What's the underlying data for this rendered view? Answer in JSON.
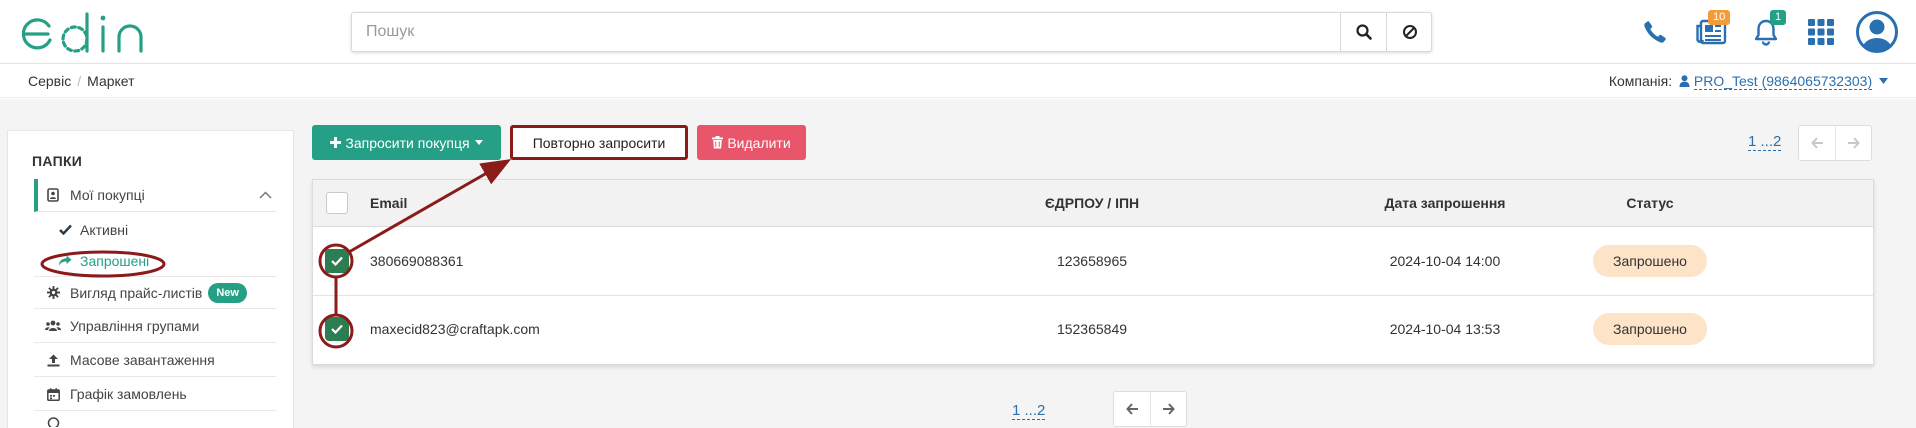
{
  "header": {
    "search_placeholder": "Пошук",
    "messages_badge": "10",
    "notifications_badge": "1"
  },
  "breadcrumb": {
    "items": [
      "Сервіс",
      "Маркет"
    ]
  },
  "company": {
    "label": "Компанія:",
    "value": "PRO_Test (9864065732303)"
  },
  "sidebar": {
    "title": "ПАПКИ",
    "my_purchases": "Мої покупці",
    "active": "Активні",
    "invited": "Запрошені",
    "price_view": "Вигляд прайс-листів",
    "new_badge": "New",
    "groups": "Управління групами",
    "bulk_upload": "Масове завантаження",
    "order_schedule": "Графік замовлень"
  },
  "toolbar": {
    "invite_buyer": "Запросити покупця",
    "reinvite": "Повторно запросити",
    "delete": "Видалити"
  },
  "pagination": {
    "label": "1 ...2"
  },
  "table": {
    "columns": [
      "Email",
      "ЄДРПОУ / ІПН",
      "Дата запрошення",
      "Статус"
    ],
    "rows": [
      {
        "email": "380669088361",
        "code": "123658965",
        "date": "2024-10-04 14:00",
        "status": "Запрошено"
      },
      {
        "email": "maxecid823@craftapk.com",
        "code": "152365849",
        "date": "2024-10-04 13:53",
        "status": "Запрошено"
      }
    ]
  },
  "colors": {
    "brand": "#25a086",
    "danger": "#e9556a",
    "annotation": "#8b1a1a",
    "status_bg": "#fde3c8",
    "link": "#2a6fb0"
  }
}
